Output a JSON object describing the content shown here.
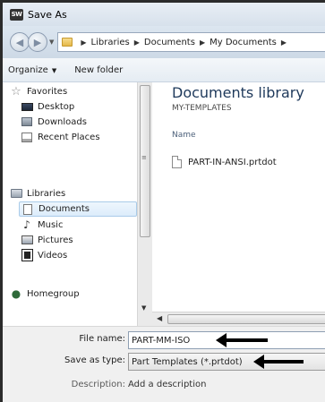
{
  "window": {
    "title": "Save As",
    "icon_text": "SW"
  },
  "navigation": {
    "breadcrumb": [
      "Libraries",
      "Documents",
      "My Documents"
    ]
  },
  "toolbar": {
    "organize_label": "Organize",
    "new_folder_label": "New folder"
  },
  "sidebar": {
    "favorites": {
      "label": "Favorites",
      "items": [
        "Desktop",
        "Downloads",
        "Recent Places"
      ]
    },
    "libraries": {
      "label": "Libraries",
      "items": [
        "Documents",
        "Music",
        "Pictures",
        "Videos"
      ],
      "selected": "Documents"
    },
    "homegroup": {
      "label": "Homegroup"
    }
  },
  "content": {
    "library_title": "Documents library",
    "library_subtitle": "MY-TEMPLATES",
    "column_name": "Name",
    "files": [
      {
        "name": "PART-IN-ANSI.prtdot"
      }
    ]
  },
  "form": {
    "file_name_label": "File name:",
    "file_name_value": "PART-MM-ISO",
    "save_as_type_label": "Save as type:",
    "save_as_type_value": "Part Templates (*.prtdot)",
    "description_label": "Description:",
    "description_placeholder": "Add a description"
  }
}
